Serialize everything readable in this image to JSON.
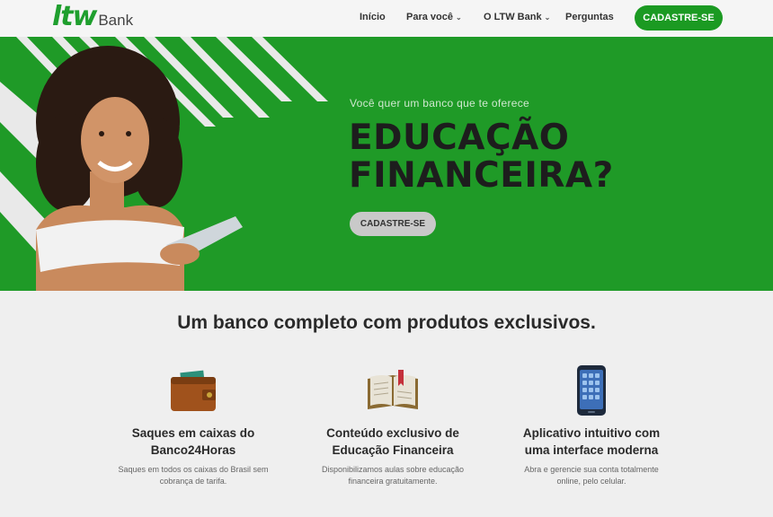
{
  "brand": {
    "mark": "ltw",
    "word": "Bank",
    "color": "#1f9f2e"
  },
  "nav": {
    "items": [
      {
        "label": "Início"
      },
      {
        "label": "Para você",
        "icon": "chevron-down-icon"
      },
      {
        "label": "O LTW Bank",
        "icon": "chevron-down-icon"
      },
      {
        "label": "Perguntas"
      }
    ],
    "cta_label": "CADASTRE-SE"
  },
  "hero": {
    "kicker": "Você quer um banco que te oferece",
    "title_line1": "EDUCAÇÃO",
    "title_line2": "FINANCEIRA?",
    "cta_label": "CADASTRE-SE",
    "background_color": "#1f9a27"
  },
  "section": {
    "title": "Um banco completo com produtos exclusivos."
  },
  "features": [
    {
      "icon": "wallet-icon",
      "title_line1": "Saques em caixas do",
      "title_line2": "Banco24Horas",
      "desc_line1": "Saques em todos os caixas do Brasil sem",
      "desc_line2": "cobrança de tarifa."
    },
    {
      "icon": "book-icon",
      "title_line1": "Conteúdo exclusivo de",
      "title_line2": "Educação Financeira",
      "desc_line1": "Disponibilizamos aulas sobre educação",
      "desc_line2": "financeira gratuitamente."
    },
    {
      "icon": "smartphone-icon",
      "title_line1": "Aplicativo intuitivo com",
      "title_line2": "uma interface moderna",
      "desc_line1": "Abra e gerencie sua conta totalmente",
      "desc_line2": "online, pelo celular."
    }
  ]
}
